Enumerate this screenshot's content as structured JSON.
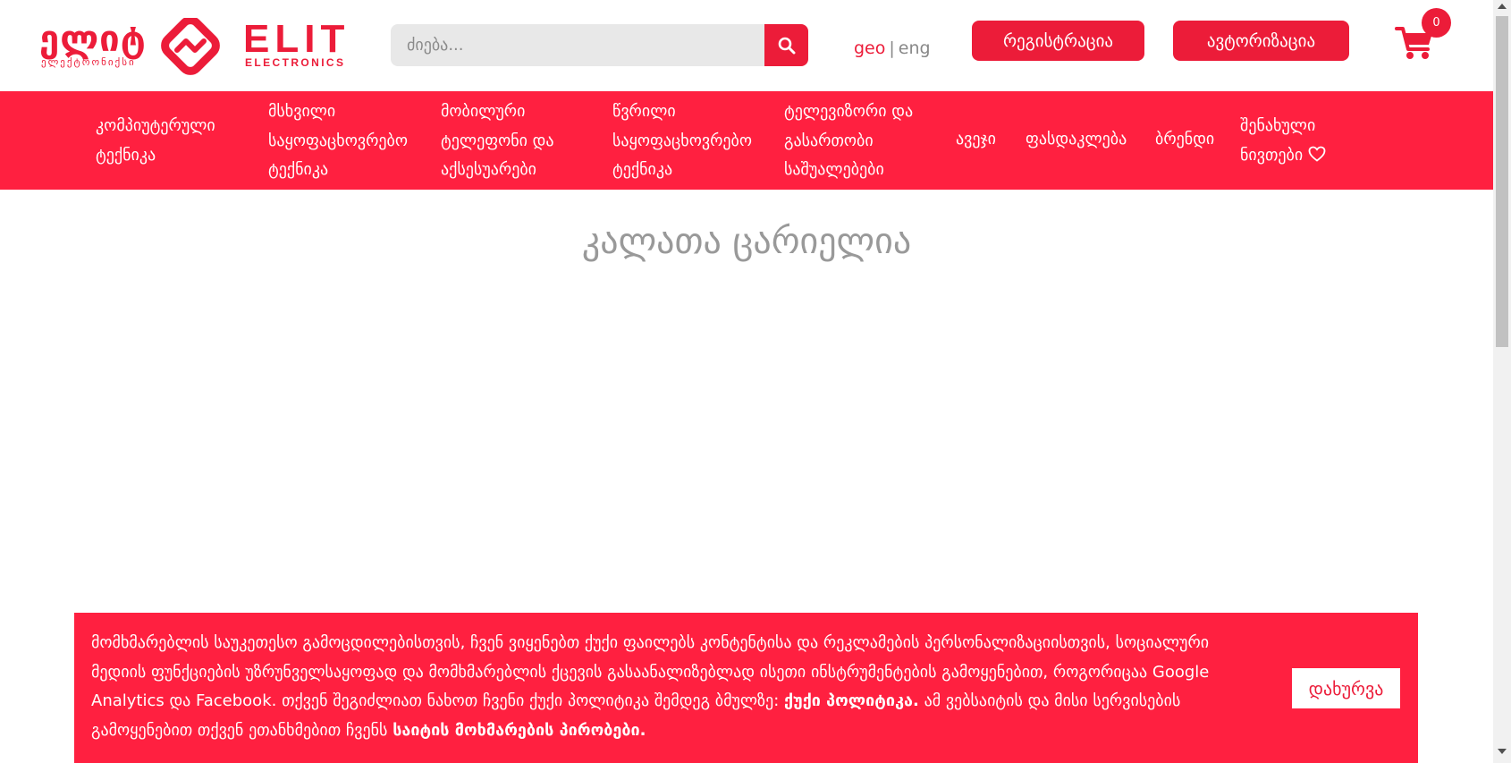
{
  "header": {
    "logo": {
      "geo_word": "ელიტ",
      "geo_sub": "ელექტრონიქსი",
      "en_word": "ELIT",
      "en_sub": "ELECTRONICS"
    },
    "search": {
      "placeholder": "ძიება..."
    },
    "lang": {
      "geo": "geo",
      "separator": "|",
      "eng": "eng"
    },
    "register_label": "რეგისტრაცია",
    "login_label": "ავტორიზაცია",
    "cart": {
      "count": "0"
    },
    "icons": {
      "search": "search-icon",
      "cart": "cart-icon",
      "heart": "heart-icon"
    }
  },
  "nav": {
    "items": [
      {
        "label": "კომპიუტერული ტექნიკა"
      },
      {
        "label": "მსხვილი საყოფაცხოვრებო ტექნიკა"
      },
      {
        "label": "მობილური ტელეფონი და აქსესუარები"
      },
      {
        "label": "წვრილი საყოფაცხოვრებო ტექნიკა"
      },
      {
        "label": "ტელევიზორი და გასართობი საშუალებები"
      },
      {
        "label": "ავეჯი"
      },
      {
        "label": "ფასდაკლება"
      },
      {
        "label": "ბრენდი"
      },
      {
        "label": "შენახული ნივთები"
      }
    ]
  },
  "main": {
    "empty_cart_title": "კალათა ცარიელია"
  },
  "cookie": {
    "text_part1": "მომხმარებლის საუკეთესო გამოცდილებისთვის, ჩვენ ვიყენებთ ქუქი ფაილებს კონტენტისა და რეკლამების პერსონალიზაციისთვის, სოციალური მედიის ფუნქციების უზრუნველსაყოფად და მომხმარებლის ქცევის გასაანალიზებლად ისეთი ინსტრუმენტების გამოყენებით, როგორიცაა Google Analytics და Facebook. თქვენ შეგიძლიათ ნახოთ ჩვენი ქუქი პოლიტიკა შემდეგ ბმულზე: ",
    "policy_link": "ქუქი პოლიტიკა.",
    "text_part2": " ამ ვებსაიტის და მისი სერვისების გამოყენებით თქვენ ეთანხმებით ჩვენს ",
    "terms_link": "საიტის მოხმარების პირობები.",
    "close_label": "დახურვა"
  },
  "colors": {
    "brand": "#ec1c39",
    "nav_bg": "#ff2040",
    "search_bg": "#e8e8e8",
    "muted_text": "#999999"
  }
}
